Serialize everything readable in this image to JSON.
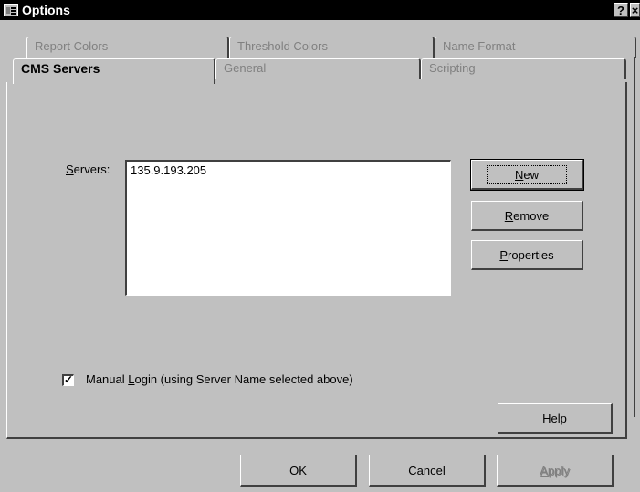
{
  "window": {
    "title": "Options",
    "help_glyph": "?",
    "close_glyph": "×"
  },
  "tabs": {
    "back_row": [
      "Report Colors",
      "Threshold Colors",
      "Name Format"
    ],
    "front_row": [
      "CMS Servers",
      "General",
      "Scripting"
    ],
    "active": "CMS Servers"
  },
  "servers": {
    "label_prefix": "",
    "label_underlined": "S",
    "label_rest": "ervers:",
    "items": [
      "135.9.193.205"
    ]
  },
  "buttons": {
    "new": {
      "u": "N",
      "rest": "ew"
    },
    "remove": {
      "u": "R",
      "rest": "emove"
    },
    "properties": {
      "u": "P",
      "rest": "roperties"
    },
    "help": {
      "u": "H",
      "rest": "elp"
    }
  },
  "manual_login": {
    "checked": true,
    "check_glyph": "✓",
    "prefix": "Manual ",
    "underlined": "L",
    "rest": "ogin (using Server Name selected above)"
  },
  "footer": {
    "ok": "OK",
    "cancel": "Cancel",
    "apply_u": "A",
    "apply_rest": "pply"
  }
}
